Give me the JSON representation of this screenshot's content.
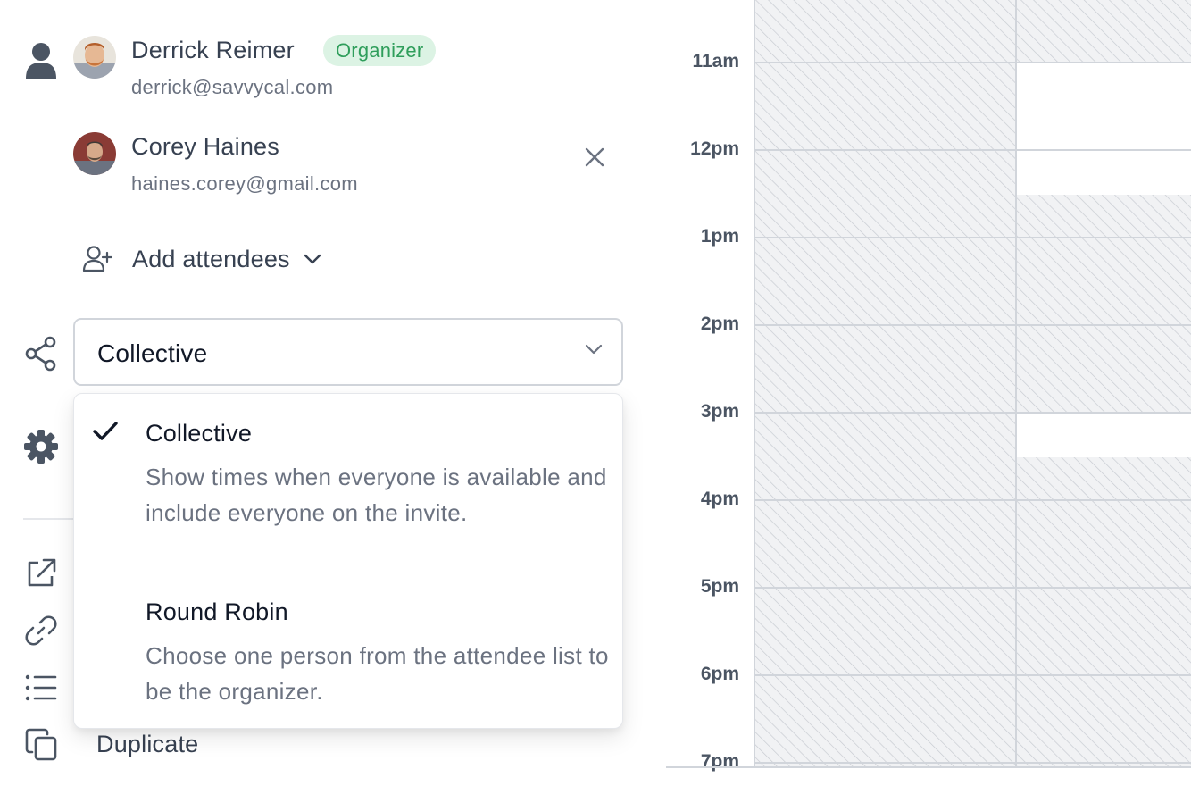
{
  "attendees": [
    {
      "name": "Derrick Reimer",
      "email": "derrick@savvycal.com",
      "badge": "Organizer"
    },
    {
      "name": "Corey Haines",
      "email": "haines.corey@gmail.com"
    }
  ],
  "add_attendees": {
    "label": "Add attendees"
  },
  "scheduling_mode": {
    "selected": "Collective",
    "options": [
      {
        "title": "Collective",
        "description": "Show times when everyone is available and include everyone on the invite.",
        "selected": true
      },
      {
        "title": "Round Robin",
        "description": "Choose one person from the attendee list to be the organizer.",
        "selected": false
      }
    ]
  },
  "actions": {
    "duplicate_label": "Duplicate"
  },
  "calendar": {
    "hours": [
      "11am",
      "12pm",
      "1pm",
      "2pm",
      "3pm",
      "4pm",
      "5pm",
      "6pm",
      "7pm"
    ]
  },
  "colors": {
    "badge_bg": "#dcf3e4",
    "badge_text": "#2f9e5b",
    "text_primary": "#111827",
    "text_muted": "#6b7280",
    "border": "#d1d5db",
    "busy_hatch": "#f0f1f4"
  }
}
